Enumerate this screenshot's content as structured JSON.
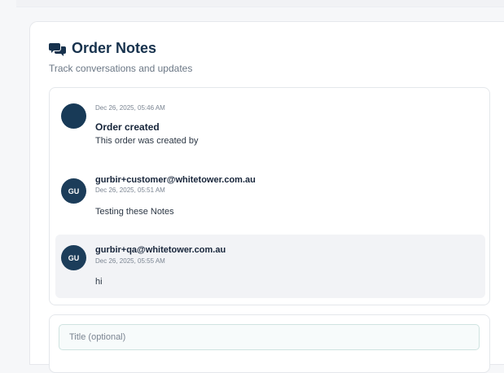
{
  "order_notes": {
    "title": "Order Notes",
    "subtitle": "Track conversations and updates",
    "icon": "chat-bubbles-icon",
    "notes": [
      {
        "timestamp": "Dec 26, 2025, 05:46 AM",
        "title": "Order created",
        "body": "This order was created by"
      },
      {
        "initials": "GU",
        "author": "gurbir+customer@whitetower.com.au",
        "timestamp": "Dec 26, 2025, 05:51 AM",
        "body": "Testing these Notes"
      },
      {
        "initials": "GU",
        "author": "gurbir+qa@whitetower.com.au",
        "timestamp": "Dec 26, 2025, 05:55 AM",
        "body": "hi"
      }
    ],
    "composer": {
      "title_placeholder": "Title (optional)",
      "title_value": ""
    }
  },
  "colors": {
    "avatar": "#1c3d5a",
    "title": "#17324d",
    "highlight_row": "#f2f3f6"
  }
}
